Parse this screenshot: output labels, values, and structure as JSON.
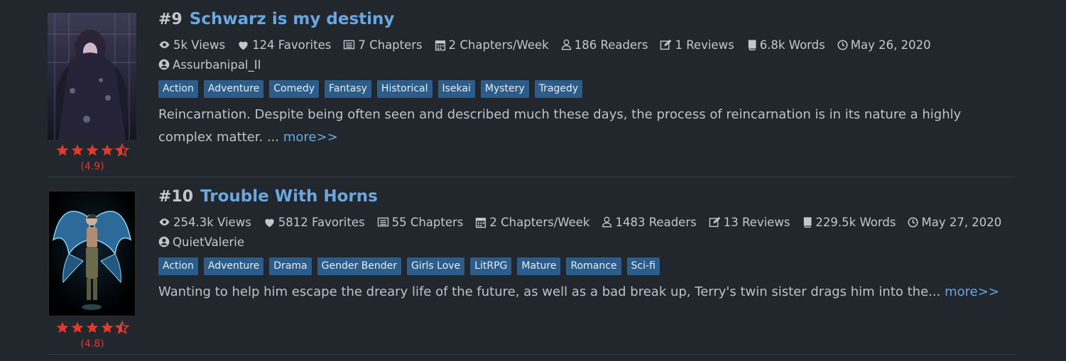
{
  "colors": {
    "background": "#22272e",
    "title_link": "#6aa6e0",
    "tag_bg": "#2b5c8a",
    "star": "#e0392f"
  },
  "novels": [
    {
      "rank": "#9",
      "title": "Schwarz is my destiny",
      "views": "5k Views",
      "favorites": "124 Favorites",
      "chapters": "7 Chapters",
      "frequency": "2 Chapters/Week",
      "readers": "186 Readers",
      "reviews": "1 Reviews",
      "words": "6.8k Words",
      "date": "May 26, 2020",
      "author": "Assurbanipal_II",
      "tags": [
        "Action",
        "Adventure",
        "Comedy",
        "Fantasy",
        "Historical",
        "Isekai",
        "Mystery",
        "Tragedy"
      ],
      "description": "Reincarnation. Despite being often seen and described much these days, the process of reincarnation is in its nature a highly complex matter. ...",
      "more_label": "more>>",
      "rating_value": 4.9,
      "rating_text": "(4.9)"
    },
    {
      "rank": "#10",
      "title": "Trouble With Horns",
      "views": "254.3k Views",
      "favorites": "5812 Favorites",
      "chapters": "55 Chapters",
      "frequency": "2 Chapters/Week",
      "readers": "1483 Readers",
      "reviews": "13 Reviews",
      "words": "229.5k Words",
      "date": "May 27, 2020",
      "author": "QuietValerie",
      "tags": [
        "Action",
        "Adventure",
        "Drama",
        "Gender Bender",
        "Girls Love",
        "LitRPG",
        "Mature",
        "Romance",
        "Sci-fi"
      ],
      "description": "Wanting to help him escape the dreary life of the future, as well as a bad break up, Terry's twin sister drags him into the...",
      "more_label": "more>>",
      "rating_value": 4.8,
      "rating_text": "(4.8)"
    }
  ]
}
